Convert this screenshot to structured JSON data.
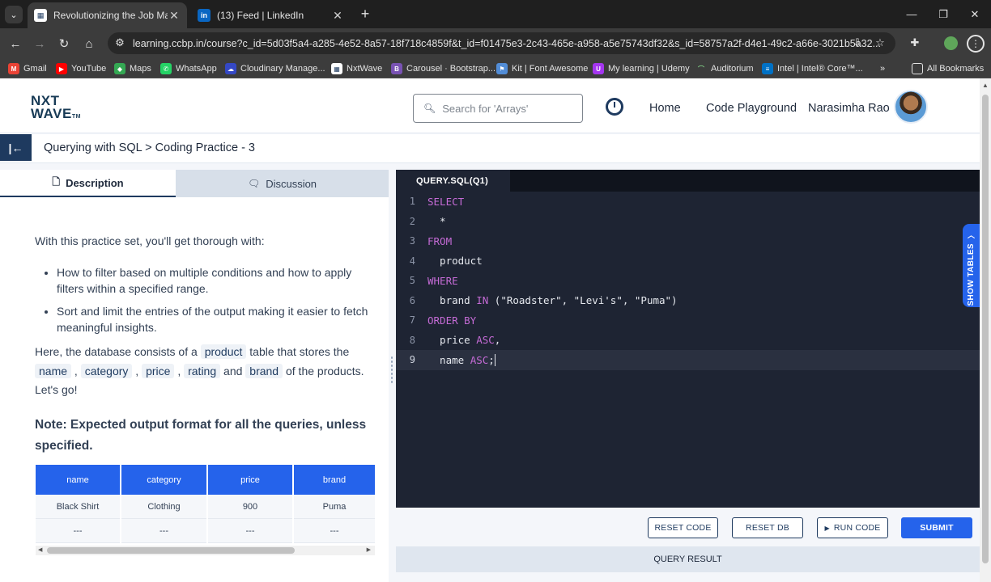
{
  "browser": {
    "tabs": [
      {
        "title": "Revolutionizing the Job Market",
        "favicon": "nxtwave-favicon",
        "active": true
      },
      {
        "title": "(13) Feed | LinkedIn",
        "favicon": "linkedin-favicon",
        "active": false
      }
    ],
    "url": "learning.ccbp.in/course?c_id=5d03f5a4-a285-4e52-8a57-18f718c4859f&t_id=f01475e3-2c43-465e-a958-a5e75743df32&s_id=58757a2f-d4e1-49c2-a66e-3021b5a32...",
    "bookmarks": [
      {
        "label": "Gmail",
        "color": "#ea4335",
        "glyph": "M"
      },
      {
        "label": "YouTube",
        "color": "#ff0000",
        "glyph": "▶"
      },
      {
        "label": "Maps",
        "color": "#34a853",
        "glyph": "◆"
      },
      {
        "label": "WhatsApp",
        "color": "#25d366",
        "glyph": "✆"
      },
      {
        "label": "Cloudinary Manage...",
        "color": "#3448c5",
        "glyph": "☁"
      },
      {
        "label": "NxtWave",
        "color": "#ffffff",
        "glyph": "▦"
      },
      {
        "label": "Carousel · Bootstrap...",
        "color": "#7952b3",
        "glyph": "B"
      },
      {
        "label": "Kit | Font Awesome",
        "color": "#528dd7",
        "glyph": "⚑"
      },
      {
        "label": "My learning | Udemy",
        "color": "#a435f0",
        "glyph": "U"
      },
      {
        "label": "Auditorium",
        "color": "#7bc47f",
        "glyph": "⌒"
      },
      {
        "label": "Intel | Intel® Core™...",
        "color": "#0071c5",
        "glyph": "≡"
      }
    ],
    "all_bookmarks": "All Bookmarks"
  },
  "header": {
    "logo_line1": "NXT",
    "logo_line2": "WAVE",
    "logo_tm": "TM",
    "search_placeholder": "Search for 'Arrays'",
    "nav_home": "Home",
    "nav_playground": "Code Playground",
    "user_name": "Narasimha Rao"
  },
  "course": {
    "breadcrumb": "Querying with SQL > Coding Practice - 3"
  },
  "panel": {
    "tab_description": "Description",
    "tab_discussion": "Discussion",
    "intro": "With this practice set, you'll get thorough with:",
    "bullets": [
      "How to filter based on multiple conditions and how to apply filters within a specified range.",
      "Sort and limit the entries of the output making it easier to fetch meaningful insights."
    ],
    "db_text_1": "Here, the database consists of a",
    "db_table": "product",
    "db_text_2": "table that stores the",
    "col_name": "name",
    "col_category": "category",
    "col_price": "price",
    "col_rating": "rating",
    "word_and": "and",
    "col_brand": "brand",
    "db_text_3": "of the products. Let's go!",
    "comma": ",",
    "note": "Note: Expected output format for all the queries, unless specified.",
    "table": {
      "headers": [
        "name",
        "category",
        "price",
        "brand"
      ],
      "rows": [
        [
          "Black Shirt",
          "Clothing",
          "900",
          "Puma"
        ],
        [
          "---",
          "---",
          "---",
          "---"
        ]
      ]
    }
  },
  "editor": {
    "file_tab": "QUERY.SQL(Q1)",
    "lines": [
      {
        "n": "1",
        "kw": "SELECT",
        "text": ""
      },
      {
        "n": "2",
        "kw": "",
        "text": "  *"
      },
      {
        "n": "3",
        "kw": "FROM",
        "text": ""
      },
      {
        "n": "4",
        "kw": "",
        "text": "  product"
      },
      {
        "n": "5",
        "kw": "WHERE",
        "text": ""
      },
      {
        "n": "6",
        "kw": "",
        "text": "  brand ",
        "kw2": "IN",
        "text2": " (\"Roadster\", \"Levi's\", \"Puma\")"
      },
      {
        "n": "7",
        "kw": "ORDER BY",
        "text": ""
      },
      {
        "n": "8",
        "kw": "",
        "text": "  price ",
        "kw2": "ASC",
        "text2": ","
      },
      {
        "n": "9",
        "kw": "",
        "text": "  name ",
        "kw2": "ASC",
        "text2": ";"
      }
    ],
    "show_tables": "SHOW TABLES",
    "btn_reset_code": "RESET CODE",
    "btn_reset_db": "RESET DB",
    "btn_run_code": "RUN CODE",
    "btn_submit": "SUBMIT",
    "query_result": "QUERY RESULT"
  }
}
